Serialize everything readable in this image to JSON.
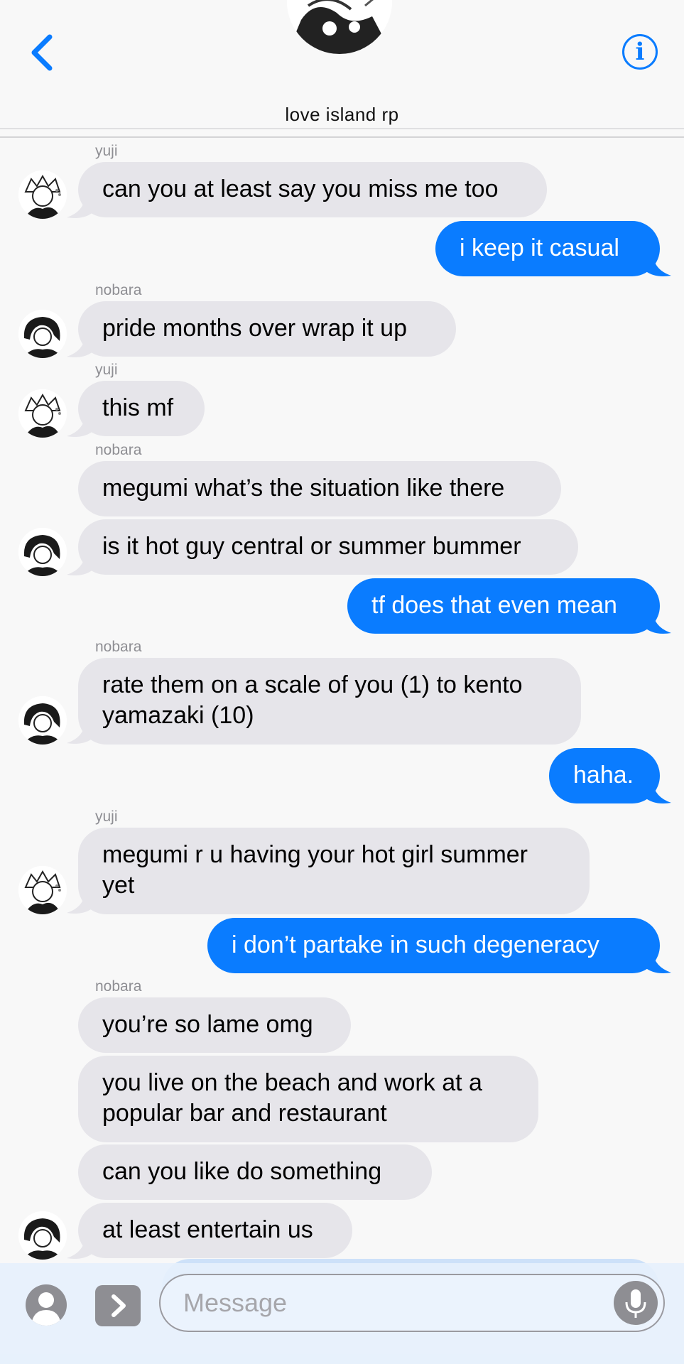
{
  "header": {
    "title": "love island rp",
    "back_icon": "chevron-left-icon",
    "info_icon": "info-icon",
    "info_glyph": "i",
    "accent": "#0a7cff"
  },
  "messages": [
    {
      "sender": "yuji",
      "text": "can you at least say you miss me too"
    },
    {
      "sender": "",
      "text": "i keep it casual"
    },
    {
      "sender": "nobara",
      "text": "pride months over wrap it up"
    },
    {
      "sender": "yuji",
      "text": "this mf"
    },
    {
      "sender": "nobara",
      "text": "megumi what’s the situation like there"
    },
    {
      "sender": "",
      "text": "is it hot guy central or summer bummer"
    },
    {
      "sender": "",
      "text": "tf does that even mean"
    },
    {
      "sender": "nobara",
      "line1": "rate them on a scale of you (1) to kento",
      "line2": "yamazaki (10)"
    },
    {
      "sender": "",
      "text": "haha."
    },
    {
      "sender": "yuji",
      "line1": "megumi r u having your hot girl summer",
      "line2": "yet"
    },
    {
      "sender": "",
      "text": "i don’t partake in such degeneracy"
    },
    {
      "sender": "nobara",
      "text": "you’re so lame omg"
    },
    {
      "sender": "",
      "line1": "you live on the beach and work at a",
      "line2": "popular bar and restaurant"
    },
    {
      "sender": "",
      "text": "can you like do something"
    },
    {
      "sender": "",
      "text": "at least entertain us"
    }
  ],
  "composer": {
    "placeholder": "Message",
    "contact_icon": "person-icon",
    "apps_icon": "chevron-right-icon",
    "mic_icon": "microphone-icon"
  },
  "colors": {
    "incoming_bubble": "#e6e5ea",
    "outgoing_bubble": "#0a7cff",
    "sender_label": "#8e8e93"
  }
}
